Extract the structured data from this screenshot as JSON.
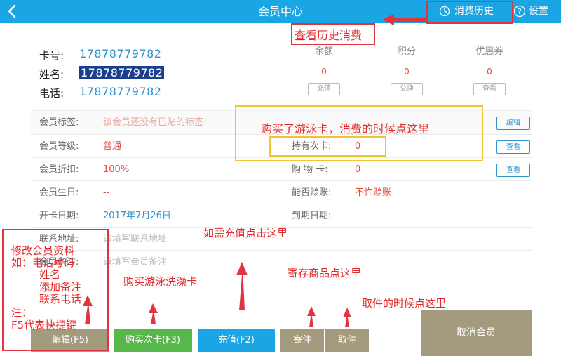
{
  "header": {
    "title": "会员中心",
    "history_label": "消费历史",
    "settings_label": "设置"
  },
  "card": {
    "card_no_label": "卡号:",
    "card_no": "17878779782",
    "name_label": "姓名:",
    "name": "17878779782",
    "phone_label": "电话:",
    "phone": "17878779782"
  },
  "stats": [
    {
      "title": "余额",
      "value": "0",
      "button": "充值"
    },
    {
      "title": "积分",
      "value": "0",
      "button": "兑换"
    },
    {
      "title": "优惠券",
      "value": "0",
      "button": "查看"
    }
  ],
  "rows": {
    "tag_label": "会员标签:",
    "tag_value": "该会员还没有已贴的标签!",
    "tag_button": "编辑",
    "level_label": "会员等级:",
    "level_value": "普通",
    "count_card_label": "持有次卡:",
    "count_card_value": "0",
    "count_card_button": "查看",
    "discount_label": "会员折扣:",
    "discount_value": "100%",
    "shopping_card_label": "购 物 卡:",
    "shopping_card_value": "0",
    "shopping_card_button": "查看",
    "birthday_label": "会员生日:",
    "birthday_value": "--",
    "credit_label": "能否赊账:",
    "credit_value": "不许赊账",
    "open_date_label": "开卡日期:",
    "open_date_value": "2017年7月26日",
    "expire_label": "到期日期:",
    "expire_value": "",
    "address_label": "联系地址:",
    "address_placeholder": "请填写联系地址",
    "remark_label": "会员备注:",
    "remark_placeholder": "请填写会员备注"
  },
  "buttons": {
    "edit": "编辑(F5)",
    "buy_card": "购买次卡(F3)",
    "recharge": "充值(F2)",
    "deposit": "寄件",
    "pickup": "取件",
    "cancel_member": "取消会员"
  },
  "annotations": {
    "history": "查看历史消费",
    "swim_card": "购买了游泳卡，消费的时候点这里",
    "recharge": "如需充值点击这里",
    "deposit": "寄存商品点这里",
    "pickup": "取件的时候点这里",
    "buy_card": "购买游泳洗澡卡",
    "note_lines": [
      "修改会员资料",
      "如：电话号码",
      "姓名",
      "添加备注",
      "联系电话",
      "注：",
      "F5代表快捷键"
    ]
  },
  "colors": {
    "header": "#1aa6e4",
    "accent_red": "#e22a2a",
    "highlight_yellow": "#f1c531"
  }
}
